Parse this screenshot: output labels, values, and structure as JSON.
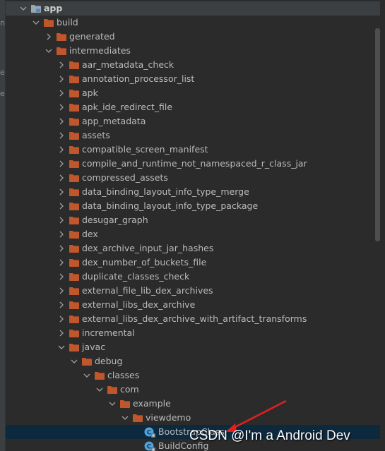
{
  "gutter": {
    "chars": [
      "n",
      "e",
      "e"
    ]
  },
  "tree": {
    "rows": [
      {
        "label": "app",
        "level": 0,
        "expanded": true,
        "icon": "module-folder-icon",
        "bold": true
      },
      {
        "label": "build",
        "level": 1,
        "expanded": true,
        "icon": "folder-icon"
      },
      {
        "label": "generated",
        "level": 2,
        "expanded": false,
        "icon": "folder-icon"
      },
      {
        "label": "intermediates",
        "level": 2,
        "expanded": true,
        "icon": "folder-icon"
      },
      {
        "label": "aar_metadata_check",
        "level": 3,
        "expanded": false,
        "icon": "folder-icon"
      },
      {
        "label": "annotation_processor_list",
        "level": 3,
        "expanded": false,
        "icon": "folder-icon"
      },
      {
        "label": "apk",
        "level": 3,
        "expanded": false,
        "icon": "folder-icon"
      },
      {
        "label": "apk_ide_redirect_file",
        "level": 3,
        "expanded": false,
        "icon": "folder-icon"
      },
      {
        "label": "app_metadata",
        "level": 3,
        "expanded": false,
        "icon": "folder-icon"
      },
      {
        "label": "assets",
        "level": 3,
        "expanded": false,
        "icon": "folder-icon"
      },
      {
        "label": "compatible_screen_manifest",
        "level": 3,
        "expanded": false,
        "icon": "folder-icon"
      },
      {
        "label": "compile_and_runtime_not_namespaced_r_class_jar",
        "level": 3,
        "expanded": false,
        "icon": "folder-icon"
      },
      {
        "label": "compressed_assets",
        "level": 3,
        "expanded": false,
        "icon": "folder-icon"
      },
      {
        "label": "data_binding_layout_info_type_merge",
        "level": 3,
        "expanded": false,
        "icon": "folder-icon"
      },
      {
        "label": "data_binding_layout_info_type_package",
        "level": 3,
        "expanded": false,
        "icon": "folder-icon"
      },
      {
        "label": "desugar_graph",
        "level": 3,
        "expanded": false,
        "icon": "folder-icon"
      },
      {
        "label": "dex",
        "level": 3,
        "expanded": false,
        "icon": "folder-icon"
      },
      {
        "label": "dex_archive_input_jar_hashes",
        "level": 3,
        "expanded": false,
        "icon": "folder-icon"
      },
      {
        "label": "dex_number_of_buckets_file",
        "level": 3,
        "expanded": false,
        "icon": "folder-icon"
      },
      {
        "label": "duplicate_classes_check",
        "level": 3,
        "expanded": false,
        "icon": "folder-icon"
      },
      {
        "label": "external_file_lib_dex_archives",
        "level": 3,
        "expanded": false,
        "icon": "folder-icon"
      },
      {
        "label": "external_libs_dex_archive",
        "level": 3,
        "expanded": false,
        "icon": "folder-icon"
      },
      {
        "label": "external_libs_dex_archive_with_artifact_transforms",
        "level": 3,
        "expanded": false,
        "icon": "folder-icon"
      },
      {
        "label": "incremental",
        "level": 3,
        "expanded": false,
        "icon": "folder-icon"
      },
      {
        "label": "javac",
        "level": 3,
        "expanded": true,
        "icon": "folder-icon"
      },
      {
        "label": "debug",
        "level": 4,
        "expanded": true,
        "icon": "folder-icon"
      },
      {
        "label": "classes",
        "level": 5,
        "expanded": true,
        "icon": "folder-icon"
      },
      {
        "label": "com",
        "level": 6,
        "expanded": true,
        "icon": "folder-icon"
      },
      {
        "label": "example",
        "level": 7,
        "expanded": true,
        "icon": "folder-icon"
      },
      {
        "label": "viewdemo",
        "level": 8,
        "expanded": true,
        "icon": "folder-icon"
      },
      {
        "label": "BootstrapClass",
        "level": 9,
        "leaf": true,
        "icon": "class-file-icon",
        "selected": true
      },
      {
        "label": "BuildConfig",
        "level": 9,
        "leaf": true,
        "icon": "class-file-icon"
      }
    ]
  },
  "watermark": {
    "text": "CSDN @I'm a Android Dev"
  },
  "colors": {
    "background": "#2b2b2b",
    "folder": "#c0562b",
    "selection": "#0d293e",
    "arrow": "#e02020",
    "class_icon": "#4aa3df"
  }
}
